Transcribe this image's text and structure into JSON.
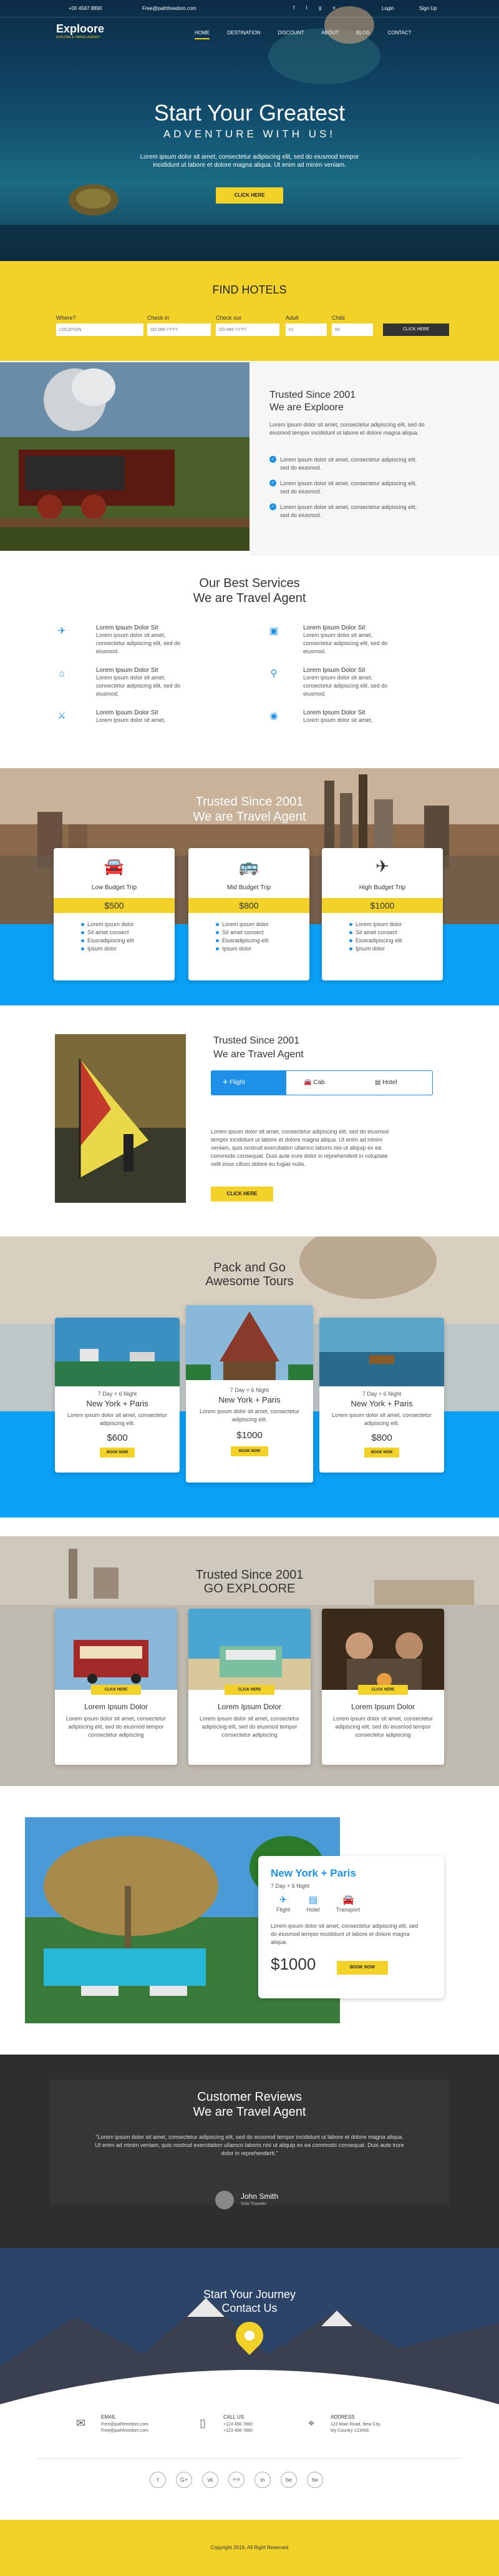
{
  "header": {
    "phone": "+00 4567 8890",
    "email": "Free@pathfreedom.com",
    "login": "Login",
    "signup": "Sign Up",
    "logo": "Exploore",
    "tagline": "EXPLORE & TRAVEL AGENCY",
    "nav": [
      "HOME",
      "DESTINATION",
      "DISCOUNT",
      "ABOUT",
      "BLOG",
      "CONTACT"
    ]
  },
  "hero": {
    "title": "Start Your Greatest",
    "subtitle": "ADVENTURE WITH US!",
    "text": "Lorem ipsum dolor sit amet, consectetur adipiscing elit, sed do eiusmod tempor incididunt ut labore et dolore magna aliqua. Ut enim ad minim veniam.",
    "button": "CLICK HERE"
  },
  "find": {
    "title": "FIND HOTELS",
    "labels": [
      "Where?",
      "Check in",
      "Check out",
      "Adult",
      "Child"
    ],
    "placeholders": [
      "LOCATION",
      "DD MM YYYY",
      "DD MM YYYY",
      "01",
      "00"
    ],
    "button": "CLICK HERE"
  },
  "trusted1": {
    "title": "Trusted Since 2001",
    "title2": "We are Exploore",
    "text": "Lorem ipsum dolor sit amet, consectetur adipiscing elit, sed do eiusmod tempor incididunt ut labore et dolore magna aliqua.",
    "items": [
      "Lorem ipsum dolor sit amet, consectetur adipiscing elit, sed do eiusmod.",
      "Lorem ipsum dolor sit amet, consectetur adipiscing elit, sed do eiusmod.",
      "Lorem ipsum dolor sit amet, consectetur adipiscing elit, sed do eiusmod."
    ]
  },
  "services": {
    "title": "Our Best Services",
    "title2": "We are Travel Agent",
    "items": [
      {
        "title": "Lorem Ipsum Dolor Sit",
        "text": "Lorem ipsum dolor sit amet, consectetur adipiscing elit, sed do eiusmod.",
        "icon": "plane-icon"
      },
      {
        "title": "Lorem Ipsum Dolor Sit",
        "text": "Lorem ipsum dolor sit amet, consectetur adipiscing elit, sed do eiusmod.",
        "icon": "luggage-icon"
      },
      {
        "title": "Lorem Ipsum Dolor Sit",
        "text": "Lorem ipsum dolor sit amet, consectetur adipiscing elit, sed do eiusmod.",
        "icon": "museum-icon"
      },
      {
        "title": "Lorem Ipsum Dolor Sit",
        "text": "Lorem ipsum dolor sit amet, consectetur adipiscing elit, sed do eiusmod.",
        "icon": "bicycle-icon"
      },
      {
        "title": "Lorem Ipsum Dolor Sit",
        "text": "Lorem ipsum dolor sit amet, consectetur adipiscing elit, sed do eiusmod.",
        "icon": "cutlery-icon"
      },
      {
        "title": "Lorem Ipsum Dolor Sit",
        "text": "Lorem ipsum dolor sit amet, consectetur adipiscing elit, sed do eiusmod.",
        "icon": "eye-icon"
      }
    ]
  },
  "pricing": {
    "title": "Trusted Since 2001",
    "title2": "We are Travel Agent",
    "plans": [
      {
        "name": "Low Budget Trip",
        "price": "$500",
        "icon": "car-icon"
      },
      {
        "name": "Mid Budget Trip",
        "price": "$800",
        "icon": "bus-icon"
      },
      {
        "name": "High Budget Trip",
        "price": "$1000",
        "icon": "plane-icon"
      }
    ],
    "features": [
      "Lorem ipsum dolor",
      "Sit amet consect",
      "Eiusradipiscing elit",
      "Ipsum dolor"
    ]
  },
  "tabs": {
    "title": "Trusted Since 2001",
    "title2": "We are Travel Agent",
    "tabs": [
      "Flight",
      "Cab",
      "Hotel"
    ],
    "text": "Lorem ipsum dolor sit amet, consectetur adipiscing elit, sed do eiusmod tempor incididunt ut labore et dolore magna aliqua. Ut enim ad minim veniam, quis nostrud exercitation ullamco laboris nisi ut aliquip ex ea commodo consequat. Duis aute irure dolor in reprehenderit in voluptate velit esse cillum dolore eu fugiat nulla.",
    "button": "CLICK HERE"
  },
  "tours": {
    "title": "Pack and Go",
    "title2": "Awesome Tours",
    "items": [
      {
        "days": "7 Day + 6 Night",
        "route": "New York + Paris",
        "text": "Lorem ipsum dolor sit amet, consectetur adipiscing elit.",
        "price": "$600",
        "button": "BOOK NOW"
      },
      {
        "days": "7 Day + 6 Night",
        "route": "New York + Paris",
        "text": "Lorem ipsum dolor sit amet, consectetur adipiscing elit.",
        "price": "$1000",
        "button": "BOOK NOW"
      },
      {
        "days": "7 Day + 6 Night",
        "route": "New York + Paris",
        "text": "Lorem ipsum dolor sit amet, consectetur adipiscing elit.",
        "price": "$800",
        "button": "BOOK NOW"
      }
    ]
  },
  "explore": {
    "title": "Trusted Since 2001",
    "title2": "GO EXPLOORE",
    "items": [
      {
        "button": "CLICK HERE",
        "title": "Lorem Ipsum Dolor",
        "text": "Lorem ipsum dolor sit amet, consectetur adipiscing elit, sed do eiusmod tempor consectetur adipiscing"
      },
      {
        "button": "CLICK HERE",
        "title": "Lorem Ipsum Dolor",
        "text": "Lorem ipsum dolor sit amet, consectetur adipiscing elit, sed do eiusmod tempor consectetur adipiscing"
      },
      {
        "button": "CLICK HERE",
        "title": "Lorem Ipsum Dolor",
        "text": "Lorem ipsum dolor sit amet, consectetur adipiscing elit, sed do eiusmod tempor consectetur adipiscing"
      }
    ]
  },
  "deal": {
    "route": "New York + Paris",
    "days": "7 Day + 6 Night",
    "icons": [
      "Flight",
      "Hotel",
      "Transport"
    ],
    "text": "Lorem ipsum dolor sit amet, consectetur adipiscing elit, sed do eiusmod tempor incididunt ut labore et dolore magna aliqua.",
    "price": "$1000",
    "button": "BOOK NOW"
  },
  "reviews": {
    "title": "Customer Reviews",
    "title2": "We are Travel Agent",
    "quote": "\"Lorem ipsum dolor sit amet, consectetur adipiscing elit, sed do eiusmod tempor incididunt ut labore et dolore magna aliqua. Ut enim ad minim veniam, quis nostrud exercitation ullamco laboris nisi ut aliquip ex ea commodo consequat. Duis aute irure dolor in reprehenderit.\"",
    "name": "John Smith",
    "role": "Solo Traveler"
  },
  "journey": {
    "title": "Start Your Journey",
    "title2": "Contact Us"
  },
  "contact": [
    {
      "label": "EMAIL",
      "line1": "Free@pathfreedom.com",
      "line2": "Free@pathfreedom.com"
    },
    {
      "label": "CALL US",
      "line1": "+123 456 7890",
      "line2": "+123 456 7890"
    },
    {
      "label": "ADDRESS",
      "line1": "123 Main Road, New City,",
      "line2": "My Country 123456"
    }
  ],
  "social": [
    "f",
    "G+",
    "vk",
    "in-yt",
    "in",
    "be",
    "tw"
  ],
  "footer": {
    "copyright": "Copyright 2019, All Right Reserved"
  },
  "colors": {
    "accent": "#f2d228",
    "blue": "#1e90e8"
  }
}
